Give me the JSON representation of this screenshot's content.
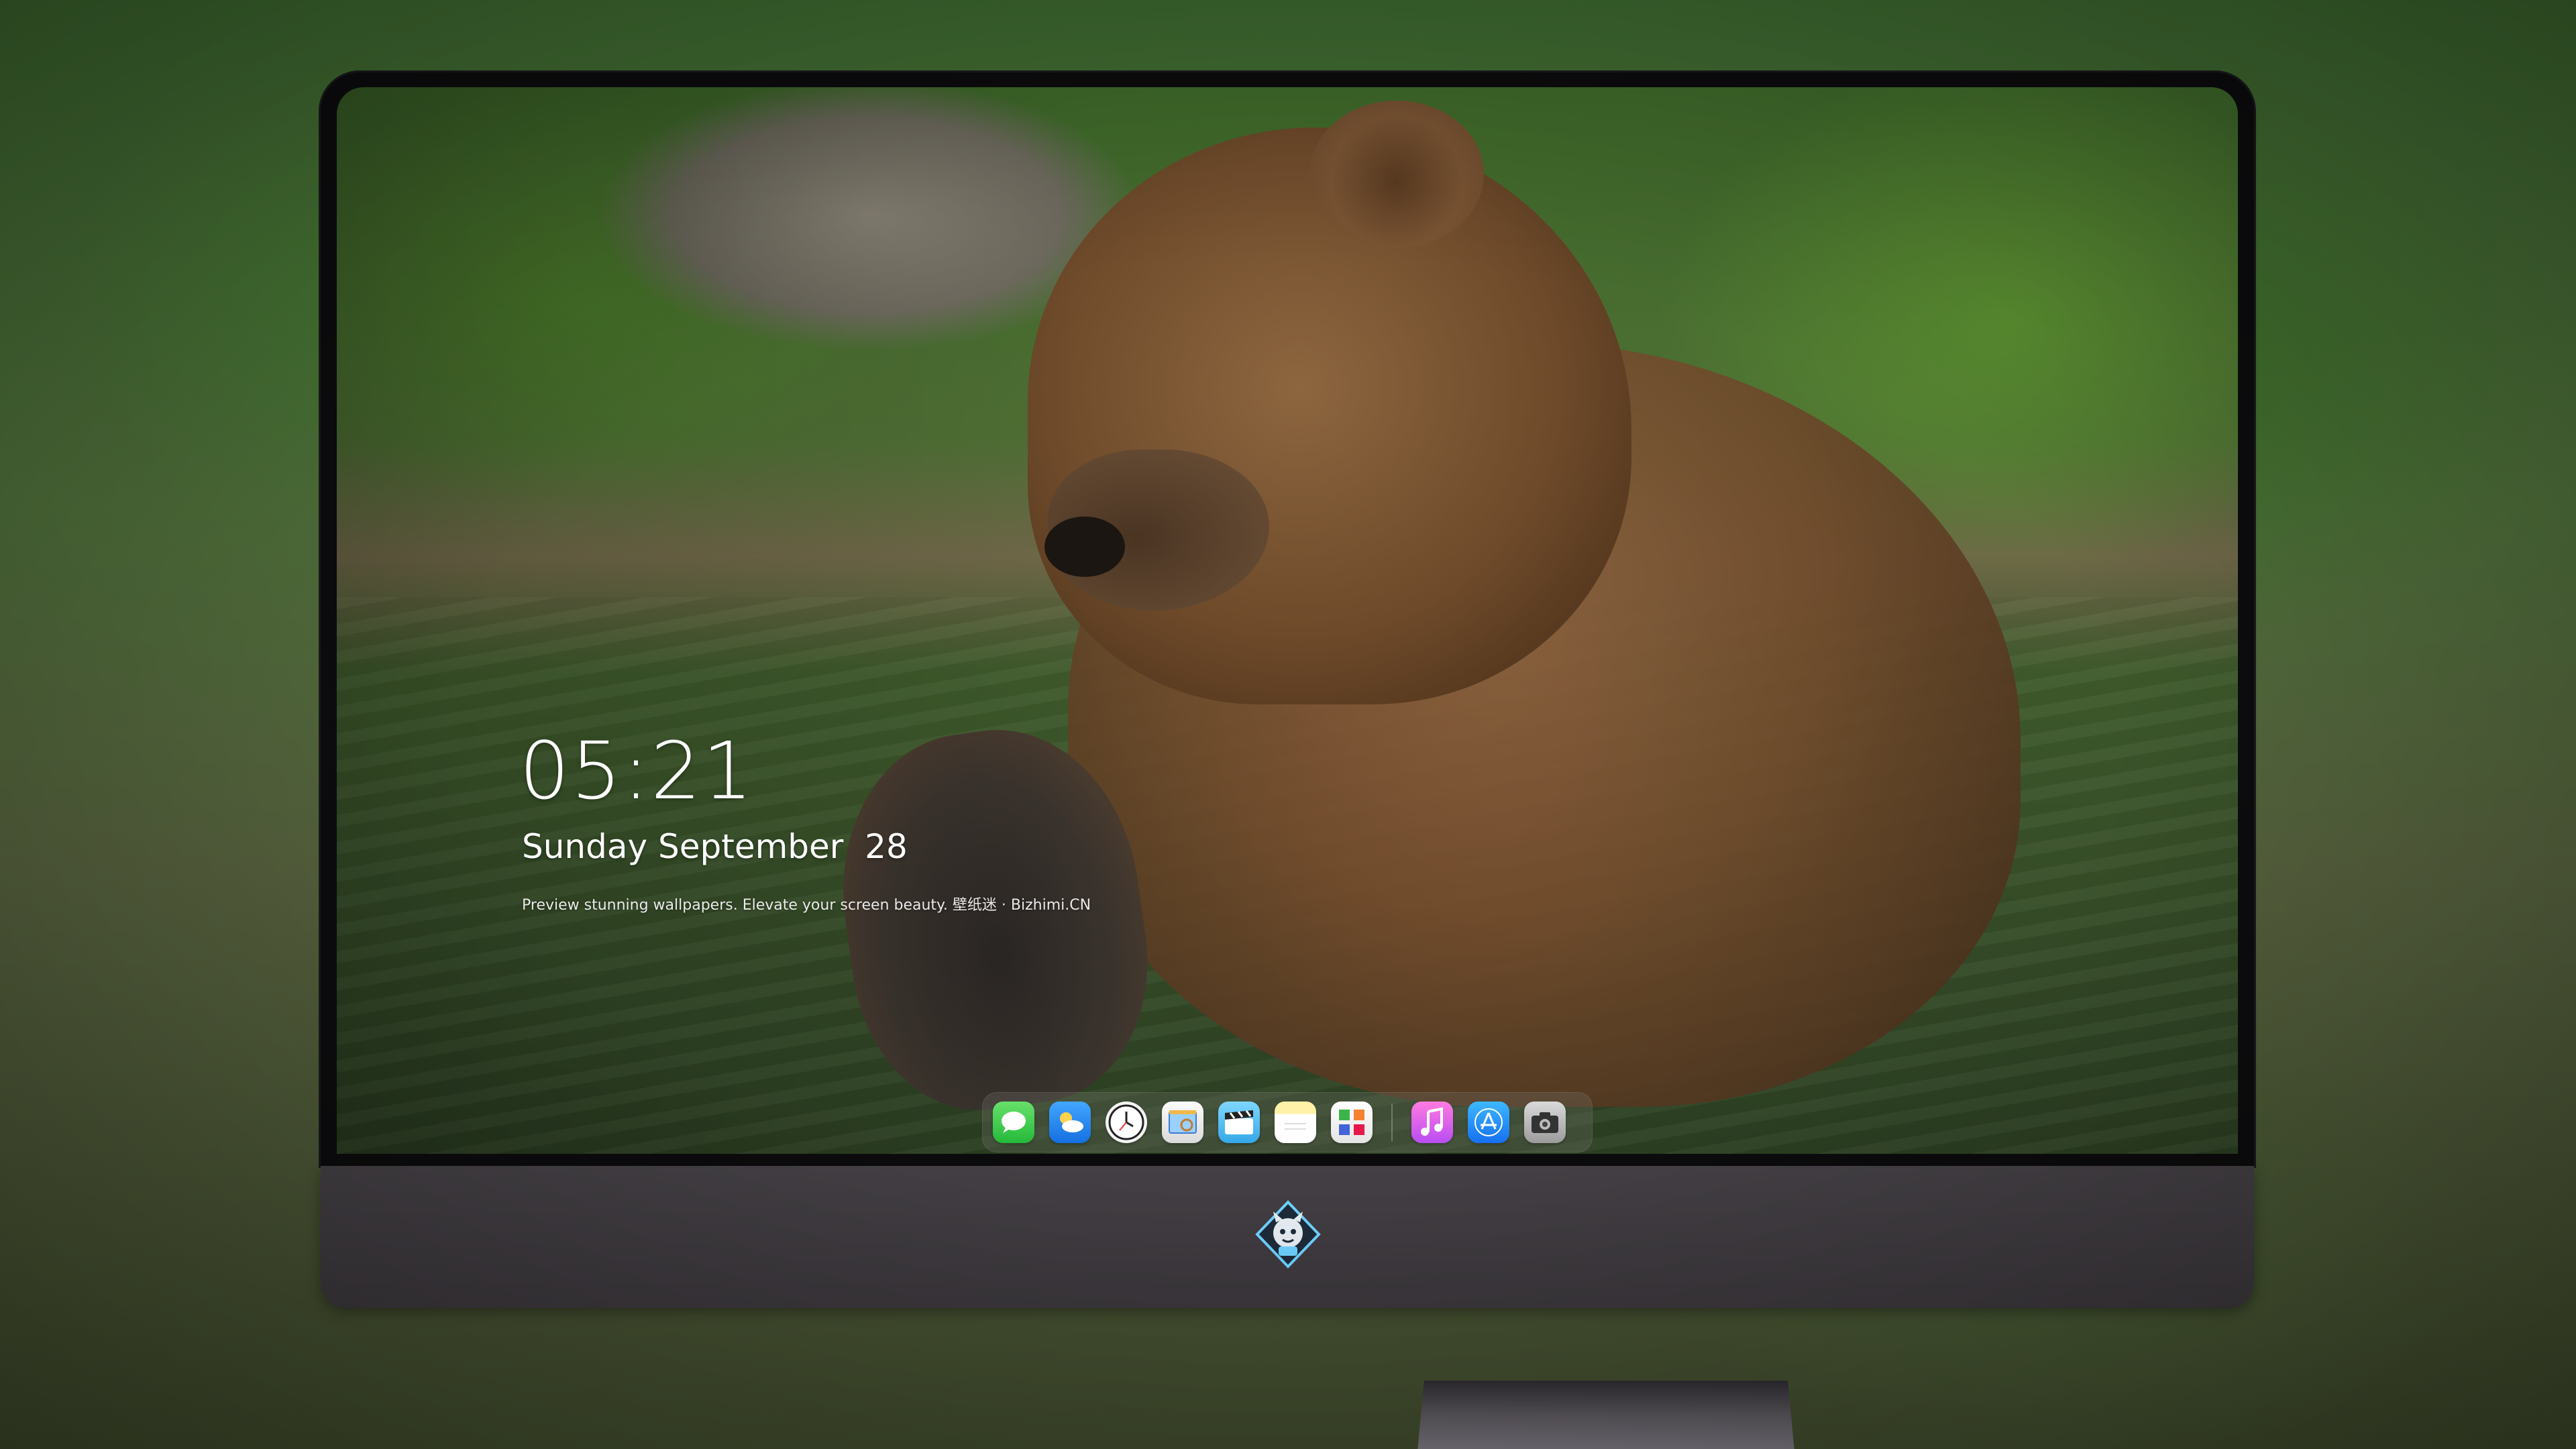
{
  "lockscreen": {
    "time": "05:21",
    "date": "Sunday September  28",
    "tagline": "Preview stunning wallpapers. Elevate your screen beauty. 壁纸迷 · Bizhimi.CN"
  },
  "dock": {
    "apps": [
      {
        "name": "messages",
        "icon": "messages-icon"
      },
      {
        "name": "weather",
        "icon": "weather-icon"
      },
      {
        "name": "clock",
        "icon": "clock-icon"
      },
      {
        "name": "preview",
        "icon": "preview-icon"
      },
      {
        "name": "clips",
        "icon": "clapperboard-icon"
      },
      {
        "name": "notes",
        "icon": "notes-icon"
      },
      {
        "name": "photo-booth",
        "icon": "photo-booth-icon"
      },
      {
        "name": "music",
        "icon": "music-note-icon"
      },
      {
        "name": "app-store",
        "icon": "app-store-icon"
      },
      {
        "name": "camera",
        "icon": "camera-icon"
      }
    ]
  },
  "monitor": {
    "chin_logo": "bizhimi-mascot-logo"
  },
  "colors": {
    "bezel": "#0c0c0e",
    "chin": "#433f44",
    "text": "#ffffff"
  }
}
